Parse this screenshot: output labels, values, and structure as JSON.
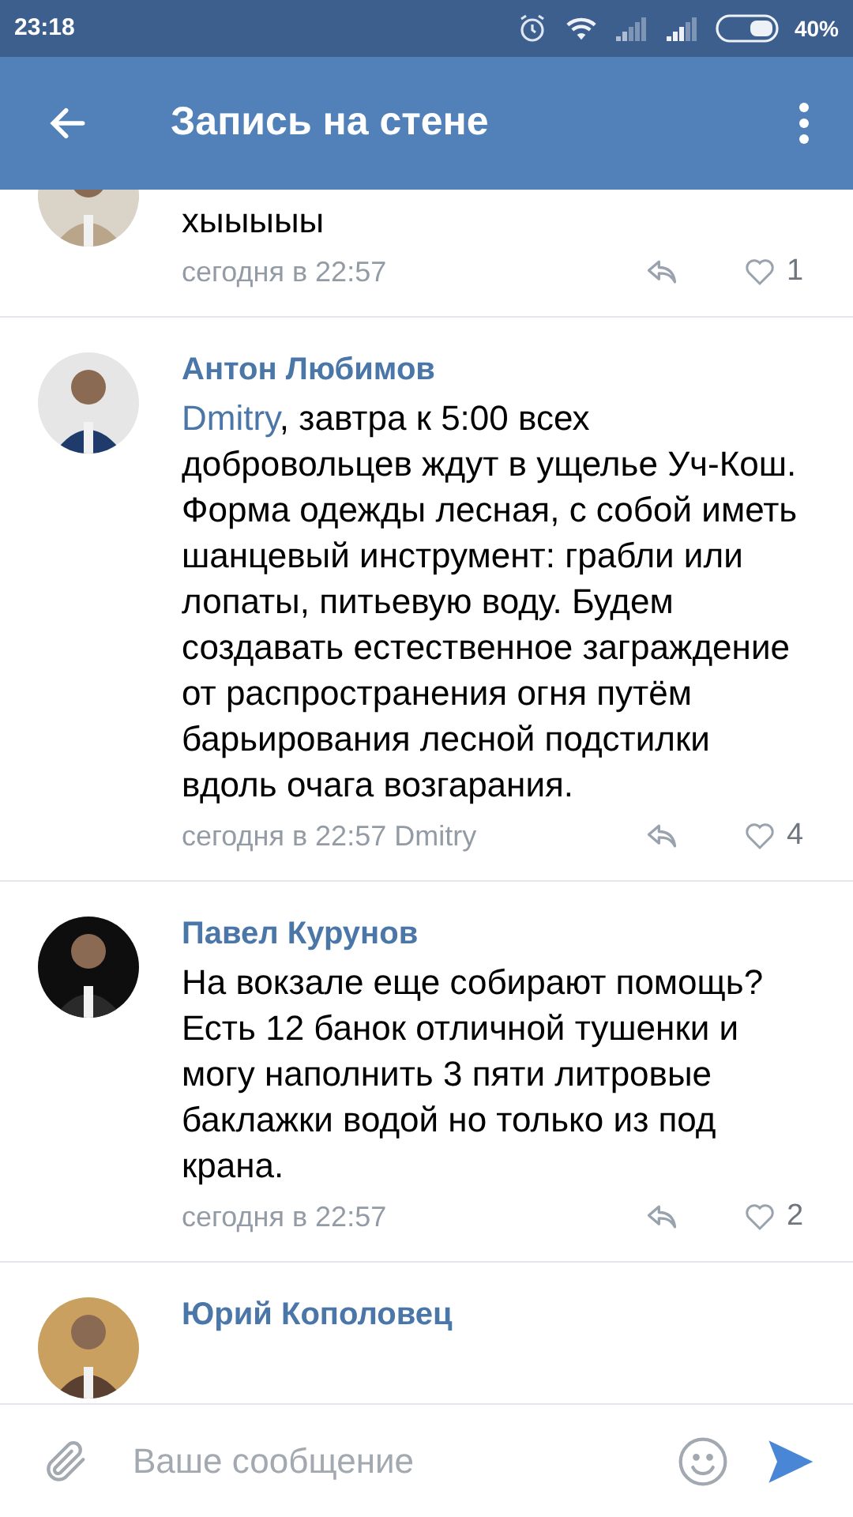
{
  "status_bar": {
    "time": "23:18",
    "battery": "40%"
  },
  "app_bar": {
    "title": "Запись на стене"
  },
  "comments": [
    {
      "text": "хыыыыы",
      "time": "сегодня в 22:57",
      "likes": "1"
    },
    {
      "name": "Антон Любимов",
      "mention": "Dmitry",
      "text": ", завтра к 5:00 всех добровольцев ждут в ущелье Уч-Кош. Форма одежды лесная, с собой иметь шанцевый инструмент: грабли или лопаты, питьевую воду. Будем  создавать естественное заграждение от распространения огня путём барьирования лесной подстилки вдоль очага возгарания.",
      "time": "сегодня в 22:57",
      "reply_to": "Dmitry",
      "likes": "4"
    },
    {
      "name": "Павел Курунов",
      "text": "На вокзале еще собирают помощь? Есть 12 банок отличной тушенки и могу наполнить 3 пяти литровые баклажки водой но только из под крана.",
      "time": "сегодня в 22:57",
      "likes": "2"
    },
    {
      "name": "Юрий Кополовец"
    }
  ],
  "composer": {
    "placeholder": "Ваше сообщение"
  }
}
